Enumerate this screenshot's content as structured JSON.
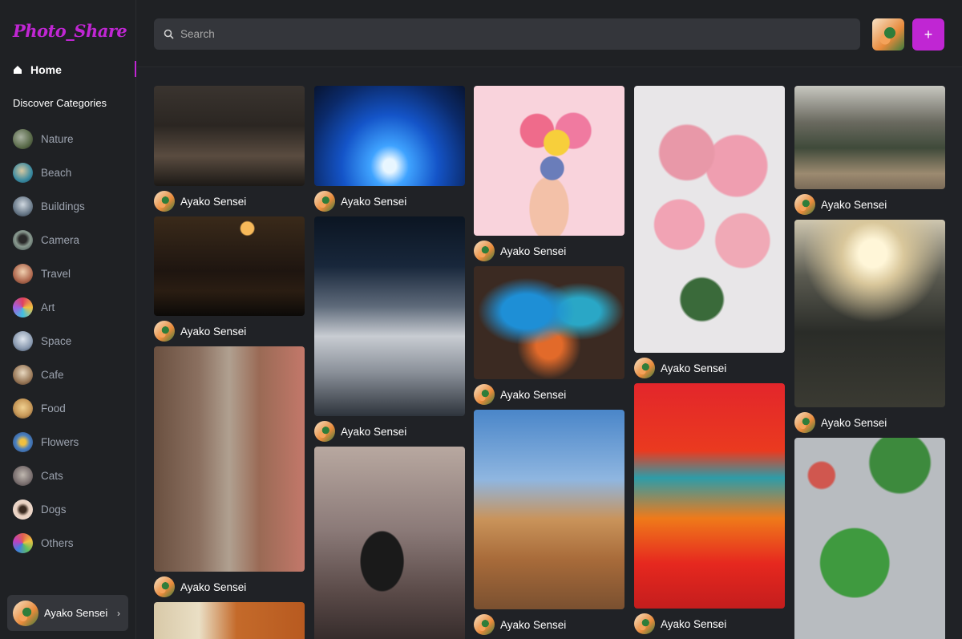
{
  "app": {
    "logo": "Photo_Share"
  },
  "nav": {
    "home_label": "Home"
  },
  "categories_title": "Discover Categories",
  "categories": [
    {
      "name": "Nature",
      "color": "#5a6b4a"
    },
    {
      "name": "Beach",
      "color": "#3a8aa0"
    },
    {
      "name": "Buildings",
      "color": "#6a7a8a"
    },
    {
      "name": "Camera",
      "color": "#4a5a5a"
    },
    {
      "name": "Travel",
      "color": "#b06a50"
    },
    {
      "name": "Art",
      "color": "#e0a040"
    },
    {
      "name": "Space",
      "color": "#8a9ab0"
    },
    {
      "name": "Cafe",
      "color": "#9a7a5a"
    },
    {
      "name": "Food",
      "color": "#c89a5a"
    },
    {
      "name": "Flowers",
      "color": "#4a80c0"
    },
    {
      "name": "Cats",
      "color": "#7a7070"
    },
    {
      "name": "Dogs",
      "color": "#e8d0c0"
    },
    {
      "name": "Others",
      "color": "#e06050"
    }
  ],
  "user": {
    "name": "Ayako Sensei"
  },
  "search": {
    "placeholder": "Search"
  },
  "header": {
    "add_label": "+"
  },
  "pins": {
    "col1": [
      "Ayako Sensei",
      "Ayako Sensei",
      "Ayako Sensei"
    ],
    "col2": [
      "Ayako Sensei",
      "Ayako Sensei"
    ],
    "col3": [
      "Ayako Sensei",
      "Ayako Sensei",
      "Ayako Sensei"
    ],
    "col4": [
      "Ayako Sensei",
      "Ayako Sensei"
    ],
    "col5": [
      "Ayako Sensei",
      "Ayako Sensei"
    ]
  },
  "colors": {
    "accent": "#c026d3",
    "bg": "#1f2124",
    "panel": "#34363b"
  }
}
